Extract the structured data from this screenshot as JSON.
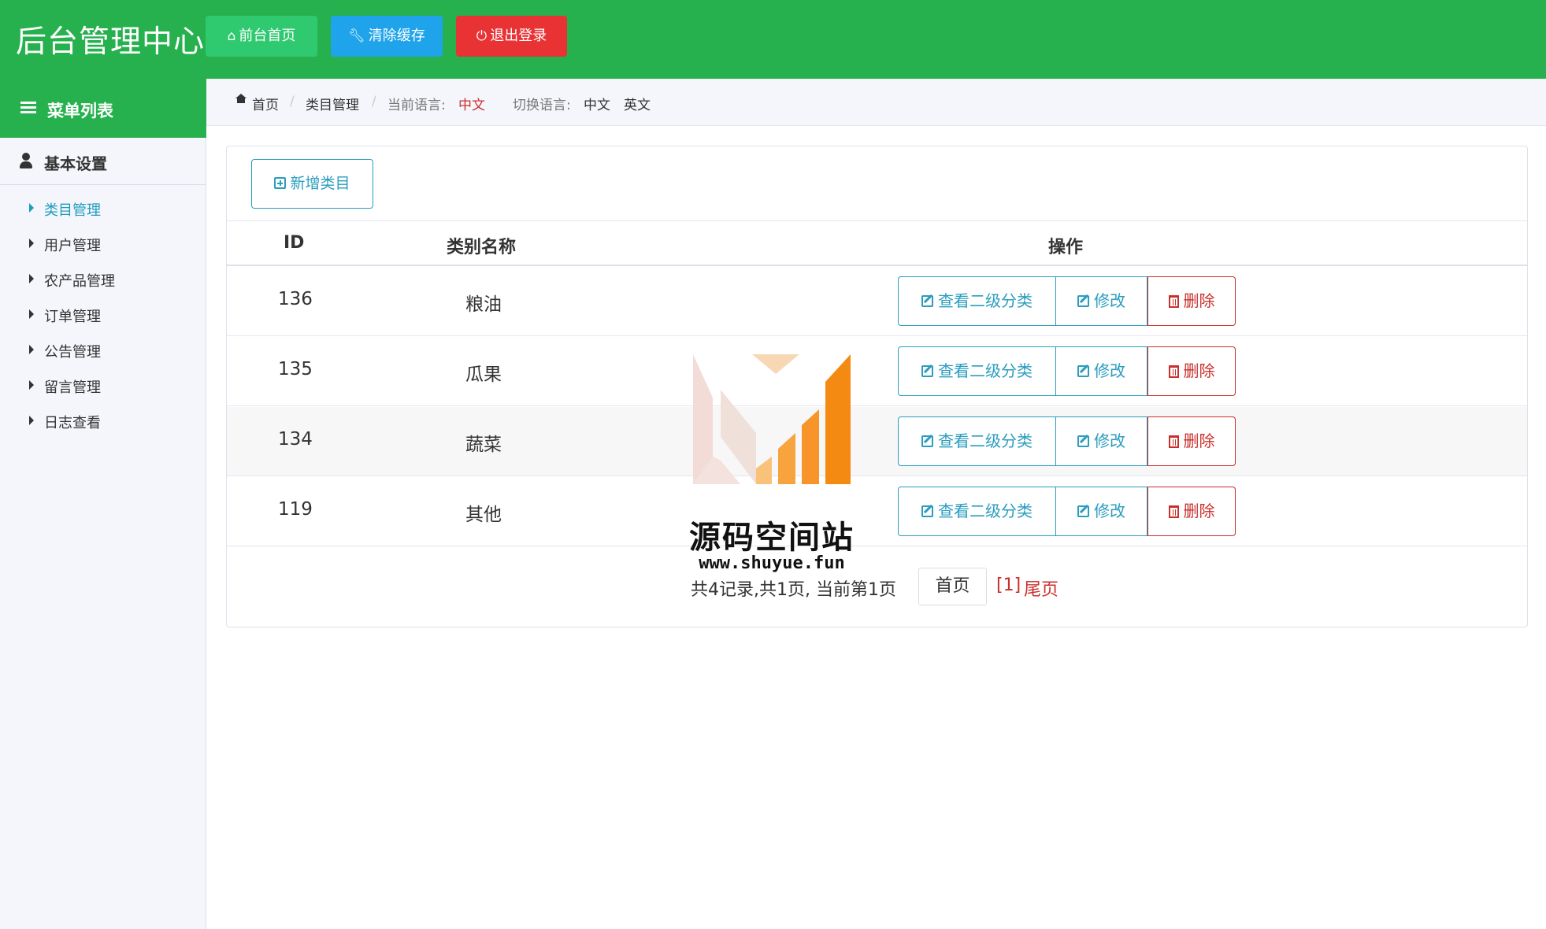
{
  "header": {
    "title": "后台管理中心",
    "buttons": {
      "home": "前台首页",
      "clear_cache": "清除缓存",
      "logout": "退出登录"
    }
  },
  "sidebar": {
    "head": "菜单列表",
    "section": "基本设置",
    "items": [
      {
        "label": "类目管理"
      },
      {
        "label": "用户管理"
      },
      {
        "label": "农产品管理"
      },
      {
        "label": "订单管理"
      },
      {
        "label": "公告管理"
      },
      {
        "label": "留言管理"
      },
      {
        "label": "日志查看"
      }
    ]
  },
  "breadcrumb": {
    "home": "首页",
    "current": "类目管理",
    "lang_label": "当前语言:",
    "lang_value": "中文",
    "switch_label": "切换语言:",
    "lang_zh": "中文",
    "lang_en": "英文"
  },
  "toolbar": {
    "add_label": "新增类目"
  },
  "table": {
    "columns": [
      "ID",
      "类别名称",
      "操作"
    ],
    "rows": [
      {
        "id": "136",
        "name": "粮油"
      },
      {
        "id": "135",
        "name": "瓜果"
      },
      {
        "id": "134",
        "name": "蔬菜"
      },
      {
        "id": "119",
        "name": "其他"
      }
    ],
    "actions": {
      "view": "查看二级分类",
      "edit": "修改",
      "delete": "删除"
    }
  },
  "pager": {
    "summary": "共4记录,共1页, 当前第1页",
    "first": "首页",
    "current": "[1]",
    "last": "尾页"
  },
  "watermark": {
    "title": "源码空间站",
    "url": "www.shuyue.fun"
  },
  "colors": {
    "header_green": "#26b14e",
    "primary_blue": "#2a9dbf",
    "danger_red": "#c9302c"
  }
}
